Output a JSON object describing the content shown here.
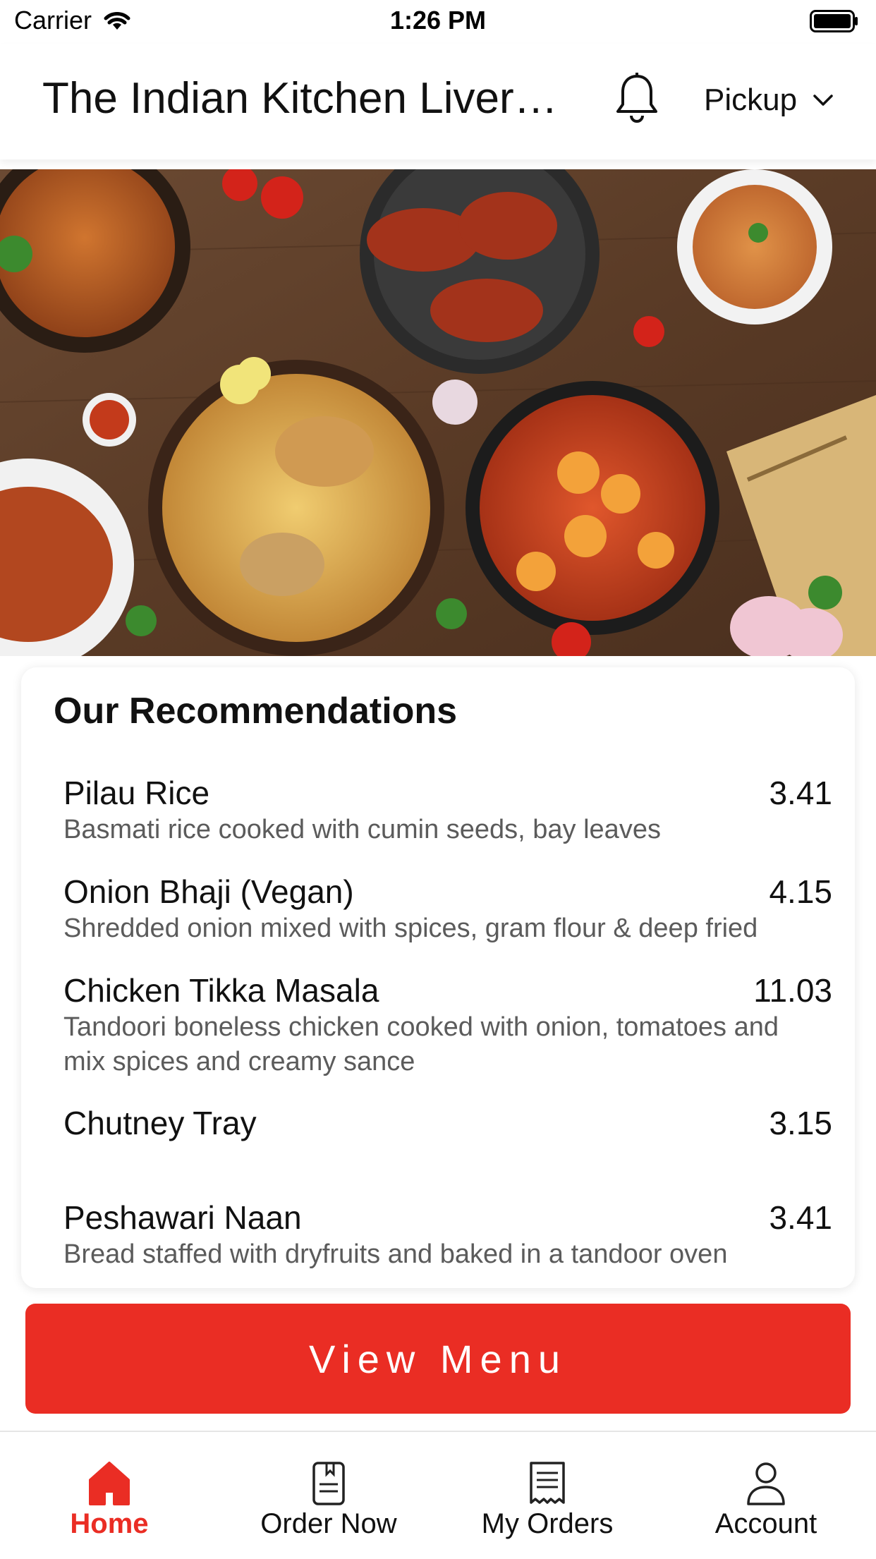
{
  "status_bar": {
    "carrier": "Carrier",
    "time": "1:26 PM"
  },
  "header": {
    "restaurant_name": "The Indian Kitchen Liverp…",
    "order_mode": "Pickup"
  },
  "recommendations": {
    "title": "Our Recommendations",
    "items": [
      {
        "name": "Pilau Rice",
        "price": "3.41",
        "description": "Basmati rice cooked with cumin seeds, bay leaves"
      },
      {
        "name": "Onion Bhaji (Vegan)",
        "price": "4.15",
        "description": "Shredded onion mixed with spices, gram flour & deep fried"
      },
      {
        "name": "Chicken Tikka Masala",
        "price": "11.03",
        "description": "Tandoori boneless chicken cooked with onion, tomatoes and mix spices and creamy sance"
      },
      {
        "name": "Chutney Tray",
        "price": "3.15",
        "description": ""
      },
      {
        "name": "Peshawari Naan",
        "price": "3.41",
        "description": "Bread staffed with dryfruits and baked in a tandoor oven"
      }
    ]
  },
  "cta": {
    "view_menu_label": "View Menu"
  },
  "tab_bar": {
    "tabs": [
      {
        "label": "Home",
        "icon": "home-icon",
        "active": true
      },
      {
        "label": "Order Now",
        "icon": "menu-book-icon",
        "active": false
      },
      {
        "label": "My Orders",
        "icon": "receipt-icon",
        "active": false
      },
      {
        "label": "Account",
        "icon": "person-icon",
        "active": false
      }
    ]
  },
  "colors": {
    "accent": "#ea2d24",
    "text_primary": "#111111",
    "text_secondary": "#5b5b5b",
    "background": "#ffffff"
  }
}
